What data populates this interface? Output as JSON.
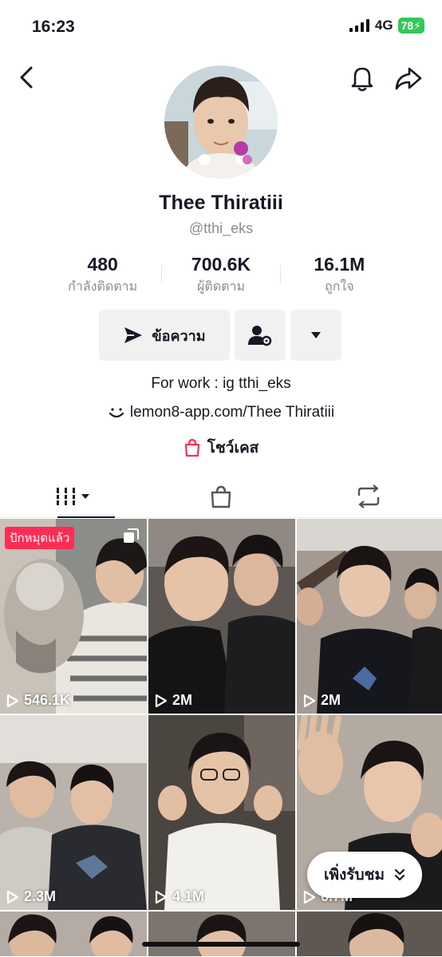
{
  "status_bar": {
    "time": "16:23",
    "network": "4G",
    "battery": "78"
  },
  "profile": {
    "display_name": "Thee Thiratiii",
    "username": "@tthi_eks",
    "stats": [
      {
        "value": "480",
        "label": "กำลังติดตาม"
      },
      {
        "value": "700.6K",
        "label": "ผู้ติดตาม"
      },
      {
        "value": "16.1M",
        "label": "ถูกใจ"
      }
    ],
    "message_button": "ข้อความ",
    "bio": "For work : ig tthi_eks",
    "link": "lemon8-app.com/Thee Thiratiii",
    "showcase": "โชว์เคส"
  },
  "tabs": [
    {
      "icon": "grid-icon",
      "active": true
    },
    {
      "icon": "shopping-bag-icon",
      "active": false
    },
    {
      "icon": "repost-icon",
      "active": false
    }
  ],
  "videos": [
    {
      "views": "546.1K",
      "pinned_label": "ปักหมุดแล้ว",
      "multi": true
    },
    {
      "views": "2M"
    },
    {
      "views": "2M"
    },
    {
      "views": "2.3M"
    },
    {
      "views": "4.1M"
    },
    {
      "views": "6.7M"
    }
  ],
  "new_videos_pill": "เพิ่งรับชม",
  "colors": {
    "accent": "#fe2c55",
    "button_bg": "#f1f1f2",
    "muted_text": "#8a8b91"
  }
}
